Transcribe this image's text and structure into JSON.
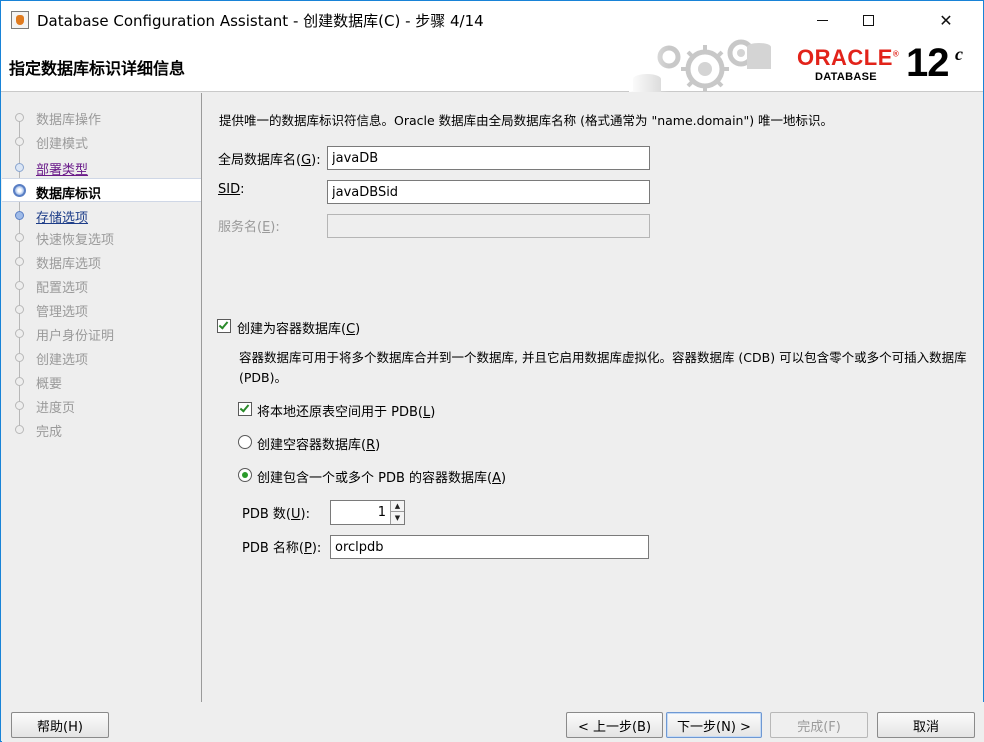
{
  "window": {
    "title": "Database Configuration Assistant - 创建数据库(C) - 步骤 4/14",
    "minimize_icon": "minimize-icon",
    "maximize_icon": "maximize-icon",
    "close_glyph": "✕"
  },
  "header": {
    "title": "指定数据库标识详细信息",
    "brand_oracle": "ORACLE",
    "brand_trademark": "®",
    "brand_database": "DATABASE",
    "brand_version": "12",
    "brand_version_suffix": "c",
    "brand_color": "#e2231a"
  },
  "nav": {
    "items": [
      {
        "label": "数据库操作",
        "state": "disabled"
      },
      {
        "label": "创建模式",
        "state": "disabled"
      },
      {
        "label": "部署类型",
        "state": "visited"
      },
      {
        "label": "数据库标识",
        "state": "current"
      },
      {
        "label": "存储选项",
        "state": "link"
      },
      {
        "label": "快速恢复选项",
        "state": "disabled"
      },
      {
        "label": "数据库选项",
        "state": "disabled"
      },
      {
        "label": "配置选项",
        "state": "disabled"
      },
      {
        "label": "管理选项",
        "state": "disabled"
      },
      {
        "label": "用户身份证明",
        "state": "disabled"
      },
      {
        "label": "创建选项",
        "state": "disabled"
      },
      {
        "label": "概要",
        "state": "disabled"
      },
      {
        "label": "进度页",
        "state": "disabled"
      },
      {
        "label": "完成",
        "state": "disabled"
      }
    ]
  },
  "form": {
    "intro": "提供唯一的数据库标识符信息。Oracle 数据库由全局数据库名称 (格式通常为 \"name.domain\") 唯一地标识。",
    "global_db_name_label": "全局数据库名(",
    "global_db_name_mnemonic": "G",
    "global_db_name_suffix": "):",
    "global_db_name_value": "javaDB",
    "sid_label": "SID",
    "sid_suffix": ":",
    "sid_value": "javaDBSid",
    "service_name_label": "服务名(",
    "service_name_mnemonic": "E",
    "service_name_suffix": "):",
    "service_name_value": "",
    "container_db_label": "创建为容器数据库(",
    "container_db_mnemonic": "C",
    "container_db_suffix": ")",
    "container_db_checked": true,
    "container_db_desc": "容器数据库可用于将多个数据库合并到一个数据库, 并且它启用数据库虚拟化。容器数据库 (CDB) 可以包含零个或多个可插入数据库 (PDB)。",
    "local_undo_label": "将本地还原表空间用于 PDB(",
    "local_undo_mnemonic": "L",
    "local_undo_suffix": ")",
    "local_undo_checked": true,
    "empty_cdb_label": "创建空容器数据库(",
    "empty_cdb_mnemonic": "R",
    "empty_cdb_suffix": ")",
    "empty_cdb_selected": false,
    "cdb_with_pdb_label": "创建包含一个或多个 PDB 的容器数据库(",
    "cdb_with_pdb_mnemonic": "A",
    "cdb_with_pdb_suffix": ")",
    "cdb_with_pdb_selected": true,
    "pdb_count_label": "PDB 数(",
    "pdb_count_mnemonic": "U",
    "pdb_count_suffix": "):",
    "pdb_count_value": "1",
    "pdb_name_label": "PDB 名称(",
    "pdb_name_mnemonic": "P",
    "pdb_name_suffix": "):",
    "pdb_name_value": "orclpdb"
  },
  "buttons": {
    "help": "帮助(H)",
    "back": "< 上一步(B)",
    "next": "下一步(N) >",
    "finish": "完成(F)",
    "cancel": "取消"
  }
}
